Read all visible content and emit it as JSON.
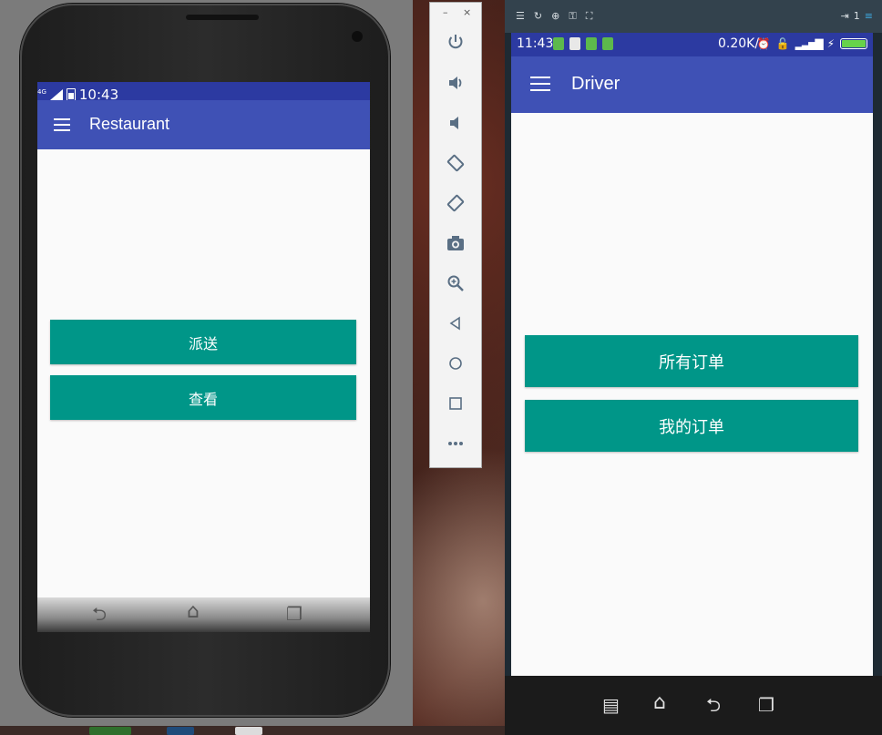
{
  "left_device": {
    "status_bar": {
      "network": "4G",
      "time": "10:43"
    },
    "app_bar": {
      "title": "Restaurant",
      "menu_icon": "hamburger-menu-icon"
    },
    "buttons": [
      {
        "label": "派送"
      },
      {
        "label": "查看"
      }
    ],
    "nav_bar": {
      "back_icon": "back-icon",
      "home_icon": "home-icon",
      "recents_icon": "recents-icon"
    }
  },
  "emulator_toolbar": {
    "window_controls": {
      "minimize": "–",
      "close": "×"
    },
    "tools": [
      {
        "icon": "power-icon",
        "glyph": "⏻"
      },
      {
        "icon": "volume-up-icon",
        "glyph": "🔊"
      },
      {
        "icon": "volume-down-icon",
        "glyph": "🔉"
      },
      {
        "icon": "rotate-left-icon",
        "glyph": "⬙"
      },
      {
        "icon": "rotate-right-icon",
        "glyph": "⬘"
      },
      {
        "icon": "camera-icon",
        "glyph": "📷"
      },
      {
        "icon": "zoom-icon",
        "glyph": "🔍"
      },
      {
        "icon": "back-triangle-icon",
        "glyph": "◁"
      },
      {
        "icon": "home-circle-icon",
        "glyph": "○"
      },
      {
        "icon": "overview-square-icon",
        "glyph": "□"
      },
      {
        "icon": "more-icon",
        "glyph": "•••"
      }
    ]
  },
  "right_device": {
    "host_bar": {
      "right_count": "1"
    },
    "status_bar": {
      "time": "11:43",
      "speed": "0.20K/s"
    },
    "app_bar": {
      "title": "Driver",
      "menu_icon": "hamburger-menu-icon"
    },
    "buttons": [
      {
        "label": "所有订单"
      },
      {
        "label": "我的订单"
      }
    ]
  },
  "colors": {
    "primary": "#3f51b5",
    "primary_dark": "#2c38a0",
    "accent_button": "#009688",
    "screen_bg": "#fafafa"
  }
}
